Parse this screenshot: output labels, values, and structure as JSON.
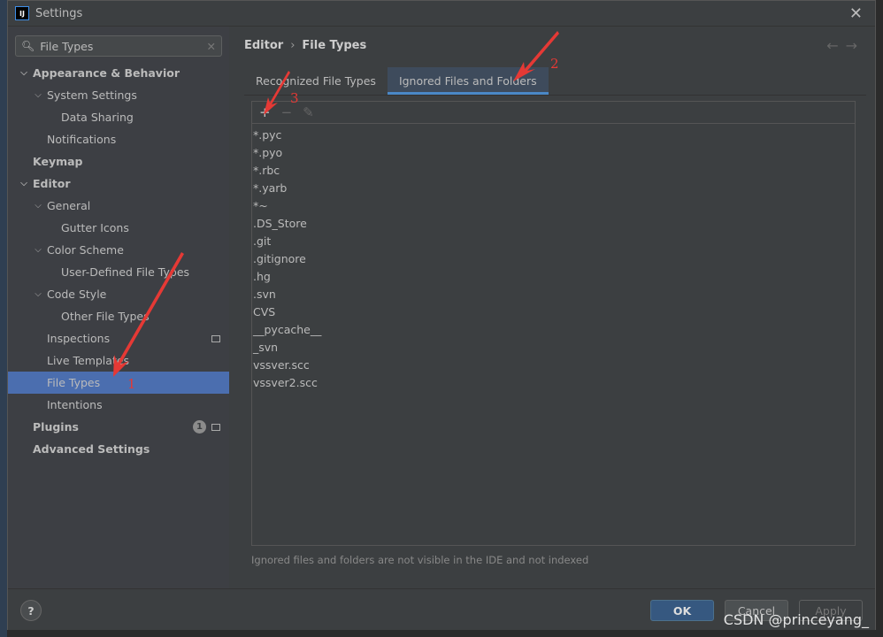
{
  "window": {
    "title": "Settings",
    "logo": "IJ"
  },
  "search": {
    "value": "File Types"
  },
  "tree": [
    {
      "label": "Appearance & Behavior",
      "level": 0,
      "bold": true,
      "chev": true
    },
    {
      "label": "System Settings",
      "level": 1,
      "chev": true
    },
    {
      "label": "Data Sharing",
      "level": 2
    },
    {
      "label": "Notifications",
      "level": 1
    },
    {
      "label": "Keymap",
      "level": 0,
      "bold": true
    },
    {
      "label": "Editor",
      "level": 0,
      "bold": true,
      "chev": true
    },
    {
      "label": "General",
      "level": 1,
      "chev": true
    },
    {
      "label": "Gutter Icons",
      "level": 2
    },
    {
      "label": "Color Scheme",
      "level": 1,
      "chev": true
    },
    {
      "label": "User-Defined File Types",
      "level": 2
    },
    {
      "label": "Code Style",
      "level": 1,
      "chev": true
    },
    {
      "label": "Other File Types",
      "level": 2
    },
    {
      "label": "Inspections",
      "level": 1,
      "page": true
    },
    {
      "label": "Live Templates",
      "level": 1
    },
    {
      "label": "File Types",
      "level": 1,
      "selected": true
    },
    {
      "label": "Intentions",
      "level": 1
    },
    {
      "label": "Plugins",
      "level": 0,
      "bold": true,
      "badge": "1",
      "page": true
    },
    {
      "label": "Advanced Settings",
      "level": 0,
      "bold": true
    }
  ],
  "breadcrumb": {
    "parent": "Editor",
    "current": "File Types"
  },
  "tabs": [
    {
      "label": "Recognized File Types"
    },
    {
      "label": "Ignored Files and Folders",
      "active": true
    }
  ],
  "ignored": [
    "*.pyc",
    "*.pyo",
    "*.rbc",
    "*.yarb",
    "*~",
    ".DS_Store",
    ".git",
    ".gitignore",
    ".hg",
    ".svn",
    "CVS",
    "__pycache__",
    "_svn",
    "vssver.scc",
    "vssver2.scc"
  ],
  "hint": "Ignored files and folders are not visible in the IDE and not indexed",
  "buttons": {
    "ok": "OK",
    "cancel": "Cancel",
    "apply": "Apply"
  },
  "annotations": {
    "n1": "1",
    "n2": "2",
    "n3": "3"
  },
  "watermark": "CSDN @princeyang_",
  "colors": {
    "selection": "#4b6eaf",
    "ok": "#365880",
    "annotation": "#e53935"
  }
}
